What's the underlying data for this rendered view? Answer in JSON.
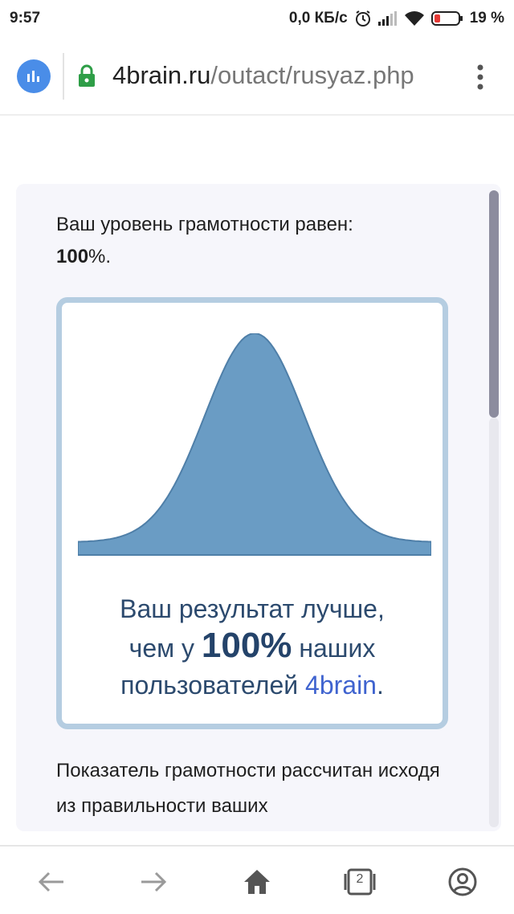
{
  "status_bar": {
    "time": "9:57",
    "network_speed": "0,0 КБ/с",
    "battery": "19 %",
    "icons": [
      "alarm-icon",
      "signal-icon",
      "wifi-icon",
      "battery-icon"
    ]
  },
  "address_bar": {
    "domain": "4brain.ru",
    "path": "/outact/rusyaz.php",
    "badge_icon": "bar-chart-icon",
    "secure_icon": "lock-icon",
    "menu_icon": "more-vert-icon"
  },
  "content": {
    "level_line": "Ваш уровень грамотности равен:",
    "level_value": "100",
    "level_suffix": "%.",
    "result_line1": "Ваш результат лучше,",
    "result_pre": "чем у ",
    "result_pct": "100%",
    "result_post": " наших",
    "result_line3": "пользователей ",
    "brand": "4brain",
    "result_end": ".",
    "footer": "Показатель грамотности рассчитан исходя из правильности ваших"
  },
  "chart_data": {
    "type": "area",
    "description_shape": "normal-distribution",
    "fill_color": "#6a9cc4",
    "stroke_color": "#4f7fa8"
  },
  "bottom_nav": {
    "tab_count": "2",
    "icons": [
      "back-arrow-icon",
      "forward-arrow-icon",
      "home-icon",
      "tabs-icon",
      "profile-icon"
    ]
  },
  "colors": {
    "accent": "#4a8de8",
    "lock": "#2e9e47",
    "box_border": "#b5cde1",
    "result_text": "#2c4a6e"
  }
}
